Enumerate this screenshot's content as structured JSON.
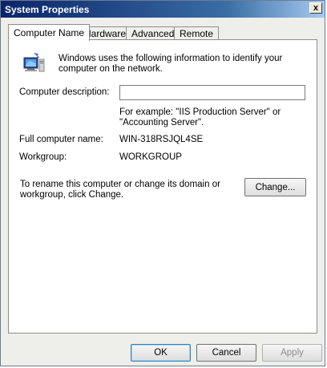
{
  "window": {
    "title": "System Properties",
    "close_label": "x"
  },
  "tabs": [
    {
      "label": "Computer Name",
      "active": true
    },
    {
      "label": "Hardware",
      "active": false
    },
    {
      "label": "Advanced",
      "active": false
    },
    {
      "label": "Remote",
      "active": false
    }
  ],
  "content": {
    "intro": "Windows uses the following information to identify your computer on the network.",
    "description_label": "Computer description:",
    "description_value": "",
    "example": "For example: \"IIS Production Server\" or \"Accounting Server\".",
    "full_name_label": "Full computer name:",
    "full_name_value": "WIN-318RSJQL4SE",
    "workgroup_label": "Workgroup:",
    "workgroup_value": "WORKGROUP",
    "rename_text": "To rename this computer or change its domain or workgroup, click Change.",
    "change_label": "Change..."
  },
  "footer": {
    "ok_label": "OK",
    "cancel_label": "Cancel",
    "apply_label": "Apply"
  },
  "icons": {
    "computer": "computer-icon",
    "close": "close-icon"
  }
}
